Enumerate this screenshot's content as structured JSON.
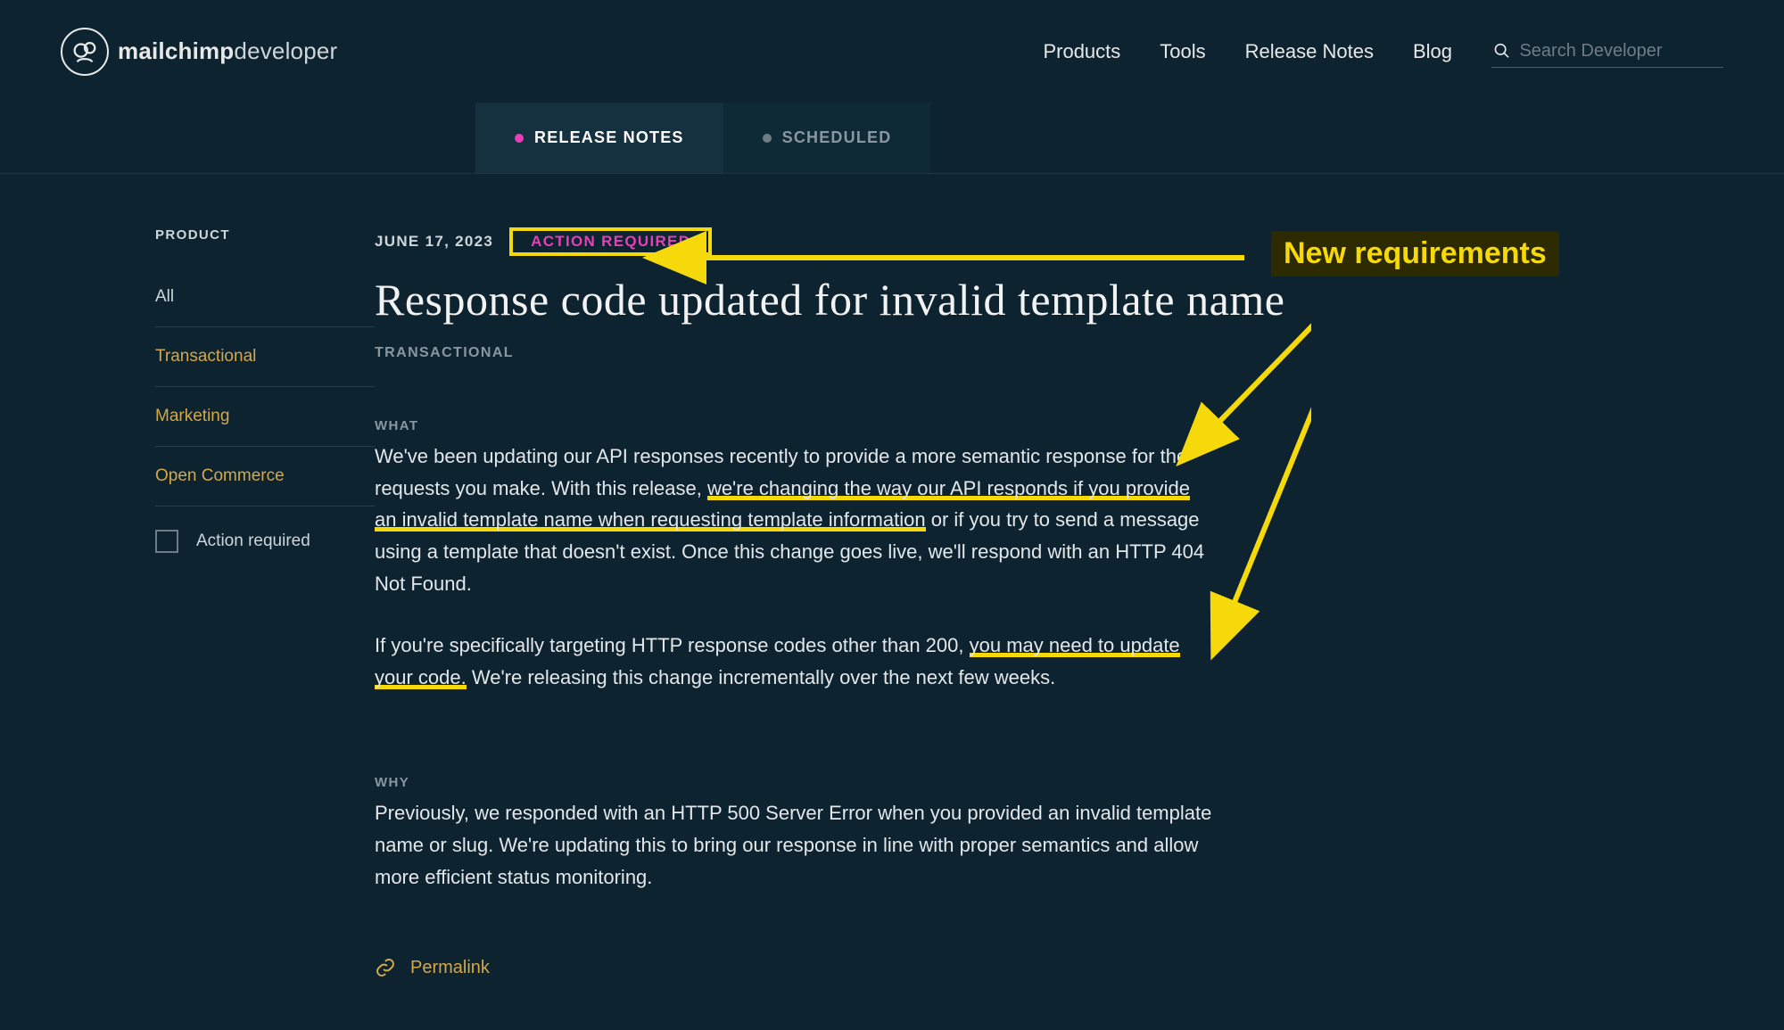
{
  "header": {
    "logo_text_bold": "mailchimp",
    "logo_text_light": "developer",
    "nav": [
      "Products",
      "Tools",
      "Release Notes",
      "Blog"
    ],
    "search_placeholder": "Search Developer"
  },
  "tabs": {
    "release_notes": "RELEASE NOTES",
    "scheduled": "SCHEDULED"
  },
  "sidebar": {
    "heading": "PRODUCT",
    "items": [
      "All",
      "Transactional",
      "Marketing",
      "Open Commerce"
    ],
    "action_required": "Action required"
  },
  "article": {
    "date": "JUNE 17, 2023",
    "badge": "ACTION REQUIRED",
    "title": "Response code updated for invalid template name",
    "category": "TRANSACTIONAL",
    "what_label": "WHAT",
    "what_p1_a": "We've been updating our API responses recently to provide a more semantic response for the requests you make. With this release, ",
    "what_p1_u1": "we're changing the way our API responds if you provide an invalid template name when requesting template information",
    "what_p1_b": " or if you try to send a message using a template that doesn't exist. Once this change goes live, we'll respond with an HTTP 404 Not Found.",
    "what_p2_a": "If you're specifically targeting HTTP response codes other than 200, ",
    "what_p2_u1": "you may need to update your code.",
    "what_p2_b": " We're releasing this change incrementally over the next few weeks.",
    "why_label": "WHY",
    "why_p1": "Previously, we responded with an HTTP 500 Server Error when you provided an invalid template name or slug. We're updating this to bring our response in line with proper semantics and allow more efficient status monitoring.",
    "permalink": "Permalink"
  },
  "annotation": {
    "callout": "New requirements"
  }
}
